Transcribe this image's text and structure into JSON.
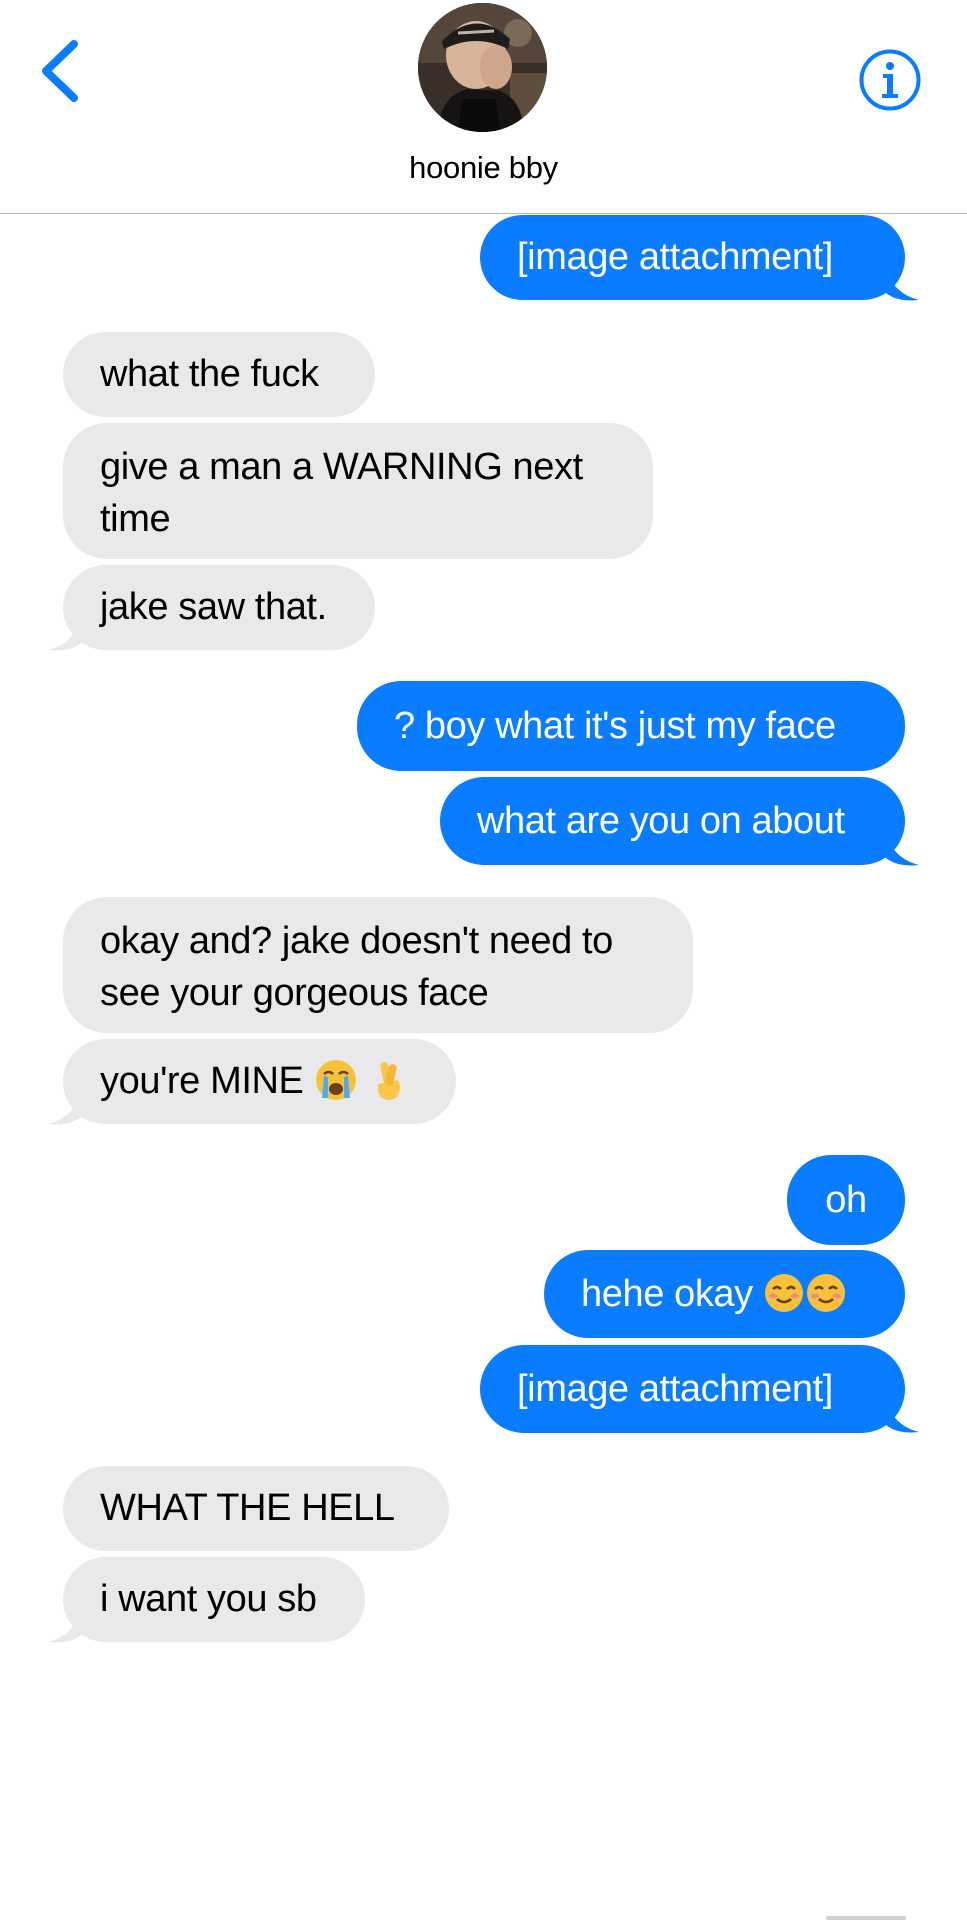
{
  "header": {
    "contact_name": "hoonie bby",
    "back_icon": "chevron-left-icon",
    "info_icon": "info-icon",
    "accent_color": "#0a7cff"
  },
  "colors": {
    "sent_bubble": "#0a7cff",
    "received_bubble": "#e9e9eb"
  },
  "messages": [
    {
      "sender": "me",
      "text": "[image attachment]"
    },
    {
      "sender": "them",
      "text": "what the fuck"
    },
    {
      "sender": "them",
      "text": "give a man a WARNING next time"
    },
    {
      "sender": "them",
      "text": "jake saw that."
    },
    {
      "sender": "me",
      "text": "? boy what it's just my face"
    },
    {
      "sender": "me",
      "text": "what are you on about"
    },
    {
      "sender": "them",
      "text": "okay and? jake doesn't need to see your gorgeous face"
    },
    {
      "sender": "them",
      "text": "you're MINE",
      "emojis": [
        "loudly-crying-face-emoji",
        "crossed-fingers-emoji"
      ]
    },
    {
      "sender": "me",
      "text": "oh"
    },
    {
      "sender": "me",
      "text": "hehe okay",
      "emojis": [
        "smiling-face-emoji",
        "smiling-face-emoji"
      ]
    },
    {
      "sender": "me",
      "text": "[image attachment]"
    },
    {
      "sender": "them",
      "text": "WHAT THE HELL"
    },
    {
      "sender": "them",
      "text": "i want you sb"
    }
  ]
}
